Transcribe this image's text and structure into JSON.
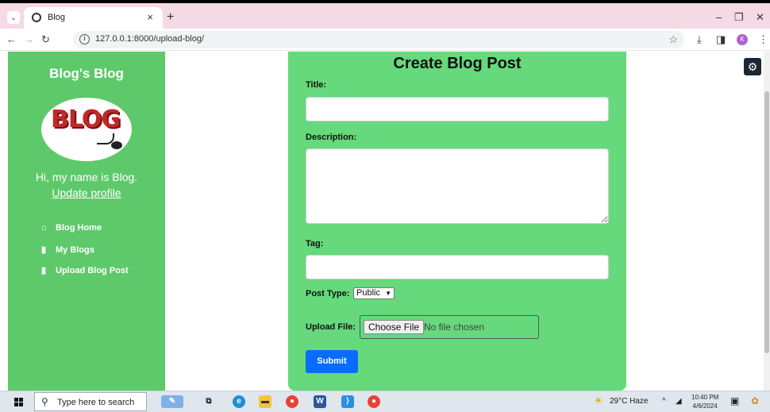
{
  "browser": {
    "tab_title": "Blog",
    "url": "127.0.0.1:8000/upload-blog/",
    "profile_initial": "K"
  },
  "sidebar": {
    "blog_name": "Blog's Blog",
    "logo_text": "BLOG",
    "greeting": "Hi, my name is Blog.",
    "profile_link": "Update profile",
    "nav": [
      {
        "label": "Blog Home",
        "icon": "home-icon"
      },
      {
        "label": "My Blogs",
        "icon": "bookmark-icon"
      },
      {
        "label": "Upload Blog Post",
        "icon": "bookmark-icon"
      }
    ]
  },
  "form": {
    "title": "Create Blog Post",
    "title_label": "Title:",
    "title_value": "",
    "description_label": "Description:",
    "description_value": "",
    "tag_label": "Tag:",
    "tag_value": "",
    "post_type_label": "Post Type:",
    "post_type_value": "Public",
    "upload_label": "Upload File:",
    "choose_file_label": "Choose File",
    "file_status": "No file chosen",
    "submit_label": "Submit"
  },
  "taskbar": {
    "search_placeholder": "Type here to search",
    "weather": "29°C  Haze",
    "time": "10:40 PM",
    "date": "4/6/2024"
  },
  "colors": {
    "sidebar": "#5ec96a",
    "form_card": "#65d97c",
    "submit": "#0a6cff"
  }
}
